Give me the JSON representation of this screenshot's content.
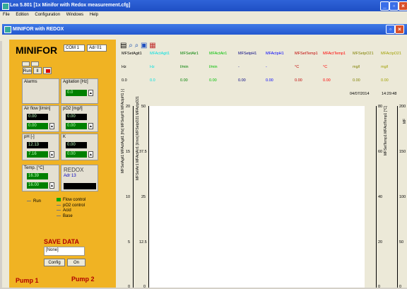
{
  "window": {
    "title": "Lea 5.801 [1x Minifor with Redox measurement.cfg]"
  },
  "menu": [
    "File",
    "Edition",
    "Configuration",
    "Windows",
    "Help"
  ],
  "child": {
    "title": "MINIFOR with REDOX"
  },
  "panel": {
    "title": "MINIFOR",
    "com": "COM 1",
    "adr": "Adr 01",
    "btn_run": "Run",
    "btn_ii": "II",
    "alarms": "Alarms",
    "agitation": {
      "label": "Agitation [Hz]",
      "value": "0.0"
    },
    "airflow": {
      "label": "Air flow [l/min]",
      "v1": "0.00",
      "v2": "0.00"
    },
    "po2": {
      "label": "pO2 [mg/l]",
      "v1": "0.00",
      "v2": "0.00"
    },
    "ph": {
      "label": "pH [-]",
      "v1": "12.13",
      "v2": "7.16"
    },
    "k": {
      "label": "K",
      "v1": "0.00",
      "v2": "0.00"
    },
    "temp": {
      "label": "Temp. [°C]",
      "v1": "16.39",
      "v2": "16.00"
    },
    "redox": {
      "label": "REDOX",
      "adr": "Adr 13"
    },
    "run_label": "Run",
    "checks": [
      "Flow control",
      "pO2 control",
      "Acid",
      "Base"
    ],
    "save": {
      "title": "SAVE DATA",
      "value": "[None]",
      "config": "Config",
      "on": "On"
    },
    "pump1": "Pump 1",
    "pump2": "Pump 2"
  },
  "table": {
    "headers": [
      {
        "text": "MFSetAgit1",
        "color": "#000000"
      },
      {
        "text": "MFActAgit1",
        "color": "#00e0e0"
      },
      {
        "text": "MFSetAir1",
        "color": "#008000"
      },
      {
        "text": "MFActAir1",
        "color": "#00c000"
      },
      {
        "text": "MFSetpH1",
        "color": "#000080"
      },
      {
        "text": "MFActpH1",
        "color": "#0000ff"
      },
      {
        "text": "MFSetTemp1",
        "color": "#c00000"
      },
      {
        "text": "MFActTemp1",
        "color": "#ff0000"
      },
      {
        "text": "MFSetpO21",
        "color": "#808000"
      },
      {
        "text": "MFActpO21",
        "color": "#a0a000"
      }
    ],
    "units": [
      "Hz",
      "Hz",
      "l/min",
      "l/min",
      "-",
      "-",
      "°C",
      "°C",
      "mg/l",
      "mg/l"
    ],
    "values": [
      "0.0",
      "0.0",
      "0.00",
      "0.00",
      "0.00",
      "0.00",
      "0.00",
      "0.00",
      "0.00",
      "0.00"
    ],
    "date": "04/07/2014",
    "time": "14:29:48"
  },
  "axes": {
    "left1": [
      "20",
      "15",
      "10",
      "5",
      "0"
    ],
    "left2": [
      "50",
      "37.5",
      "25",
      "12.5",
      "0"
    ],
    "right1": [
      "80",
      "60",
      "40",
      "20",
      "0"
    ],
    "right2": [
      "200",
      "150",
      "100",
      "50",
      "0"
    ],
    "left1_label": "MFSetAgit1 MFActAgit1 [Hz] MFSetpH1 MFActpH1 [-]",
    "left2_label": "MFSetAir1 MFActAir1 [l/min] MFSetpO21 MFActpO21",
    "right1_label": "MFSetTemp1 MFActTemp1 [°C]",
    "right2_label": "MF"
  }
}
